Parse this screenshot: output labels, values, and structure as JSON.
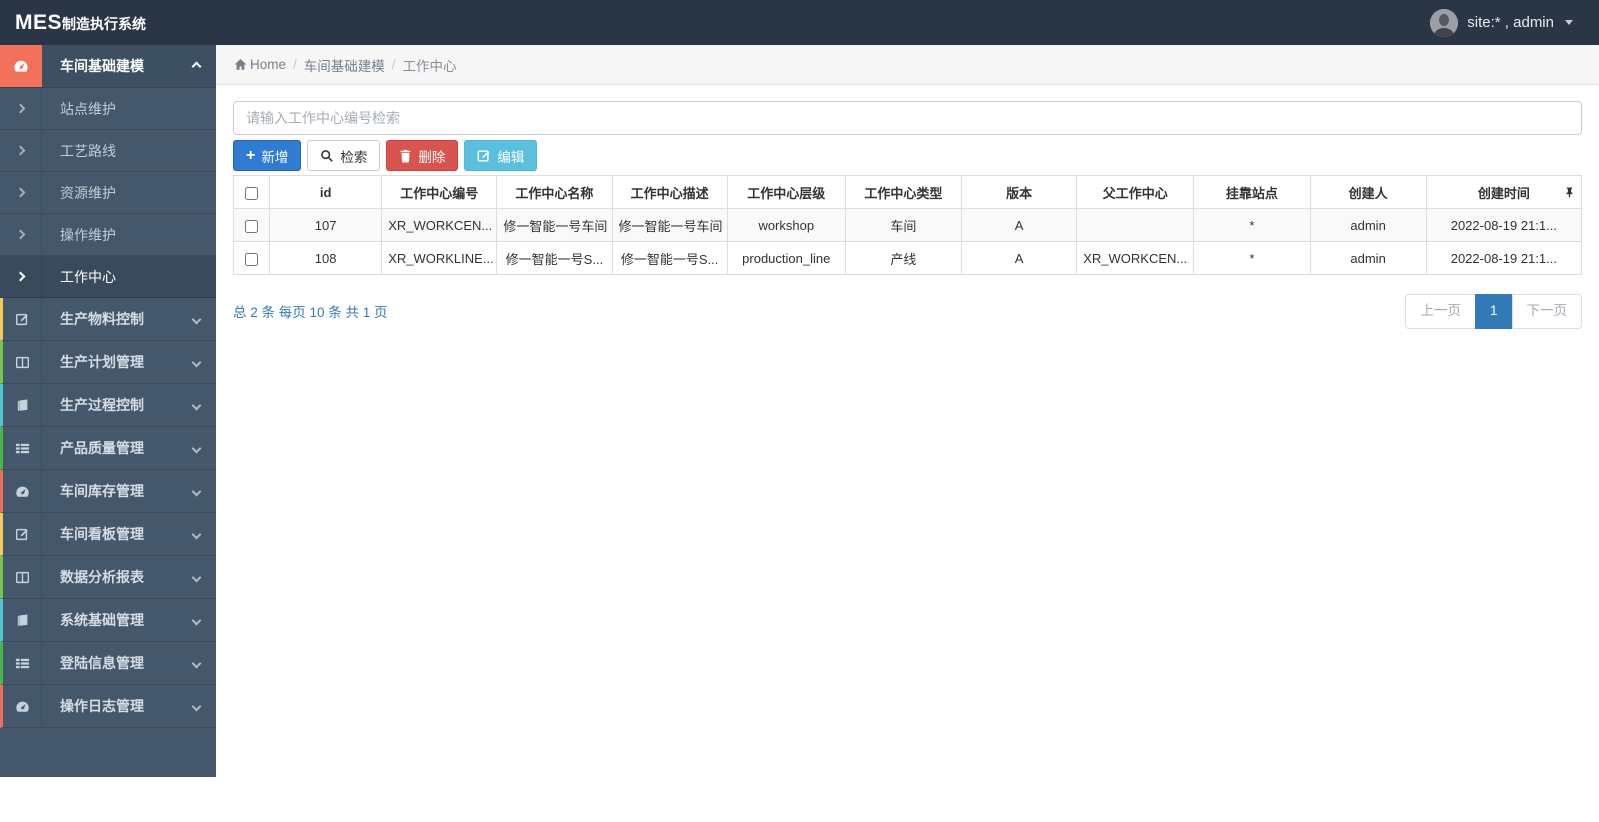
{
  "navbar": {
    "brand_mes": "MES",
    "brand_suffix": "制造执行系统",
    "user_label": "site:* , admin"
  },
  "breadcrumb": {
    "home": "Home",
    "sep": "/",
    "level1": "车间基础建模",
    "level2": "工作中心"
  },
  "sidebar": {
    "active_group": "车间基础建模",
    "submenu": [
      "站点维护",
      "工艺路线",
      "资源维护",
      "操作维护",
      "工作中心"
    ],
    "groups": [
      "生产物料控制",
      "生产计划管理",
      "生产过程控制",
      "产品质量管理",
      "车间库存管理",
      "车间看板管理",
      "数据分析报表",
      "系统基础管理",
      "登陆信息管理",
      "操作日志管理"
    ]
  },
  "toolbar": {
    "search_placeholder": "请输入工作中心编号检索",
    "add_label": "新增",
    "search_label": "检索",
    "delete_label": "删除",
    "edit_label": "编辑"
  },
  "table": {
    "headers": [
      "id",
      "工作中心编号",
      "工作中心名称",
      "工作中心描述",
      "工作中心层级",
      "工作中心类型",
      "版本",
      "父工作中心",
      "挂靠站点",
      "创建人",
      "创建时间"
    ],
    "rows": [
      {
        "id": "107",
        "code": "XR_WORKCEN...",
        "name": "修一智能一号车间",
        "desc": "修一智能一号车间",
        "level": "workshop",
        "type": "车间",
        "version": "A",
        "parent": "",
        "site": "*",
        "creator": "admin",
        "created": "2022-08-19 21:1..."
      },
      {
        "id": "108",
        "code": "XR_WORKLINE...",
        "name": "修一智能一号S...",
        "desc": "修一智能一号S...",
        "level": "production_line",
        "type": "产线",
        "version": "A",
        "parent": "XR_WORKCEN...",
        "site": "*",
        "creator": "admin",
        "created": "2022-08-19 21:1..."
      }
    ]
  },
  "pagination": {
    "summary": "总 2 条 每页 10 条 共 1 页",
    "prev_label": "上一页",
    "current_page": "1",
    "next_label": "下一页"
  },
  "colors": {
    "navbar_bg": "#2a3645",
    "sidebar_bg": "#45586b",
    "active_icon_bg": "#f3705b",
    "primary_button": "#2f7cd2",
    "danger_button": "#d9534f",
    "info_button": "#5bc0de",
    "link_blue": "#337ab7",
    "group_border_cycle": [
      "#f4c95b",
      "#77c34f",
      "#52c6d0",
      "#4cb64c",
      "#ef6f5f"
    ]
  }
}
